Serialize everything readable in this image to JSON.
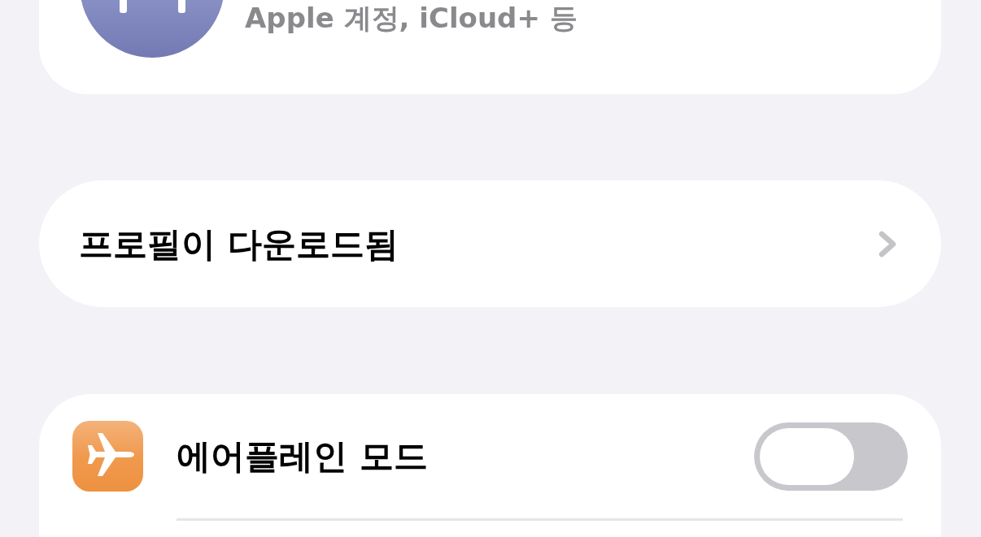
{
  "account_card": {
    "subtitle": "Apple 계정, iCloud+ 등"
  },
  "profile_row": {
    "label": "프로필이 다운로드됨"
  },
  "settings": [
    {
      "kind": "toggle",
      "label": "에어플레인 모드",
      "on": false
    }
  ]
}
